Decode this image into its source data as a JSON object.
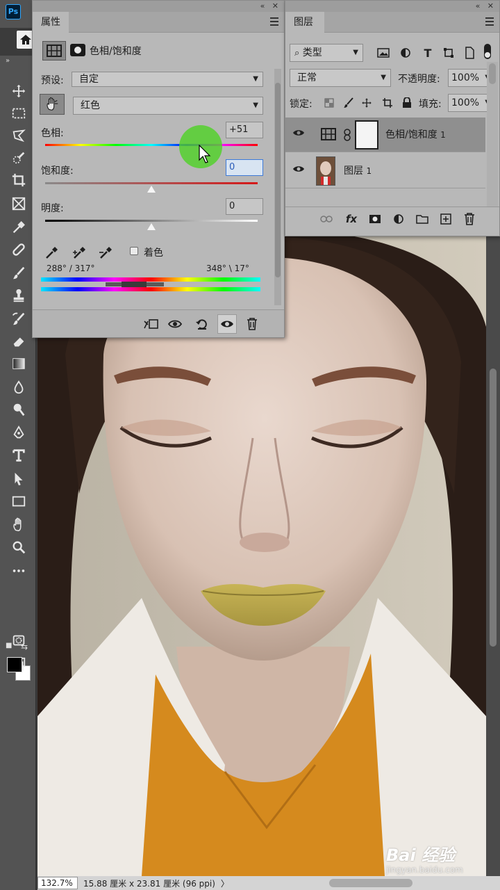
{
  "app": {
    "logo": "Ps"
  },
  "properties": {
    "tab_label": "属性",
    "title": "色相/饱和度",
    "preset_label": "预设:",
    "preset_value": "自定",
    "channel_value": "红色",
    "hue_label": "色相:",
    "hue_value": "+51",
    "saturation_label": "饱和度:",
    "saturation_value": "0",
    "lightness_label": "明度:",
    "lightness_value": "0",
    "colorize_label": "着色",
    "range_left": "288° / 317°",
    "range_right": "348° \\ 17°",
    "hue_slider_level": 0.75,
    "saturation_slider_level": 0.5,
    "lightness_slider_level": 0.5
  },
  "layers": {
    "tab_label": "图层",
    "filter_value": "类型",
    "blend_mode": "正常",
    "opacity_label": "不透明度:",
    "opacity_value": "100%",
    "lock_label": "锁定:",
    "fill_label": "填充:",
    "fill_value": "100%",
    "items": [
      {
        "name": "色相/饱和度",
        "suffix": "1"
      },
      {
        "name": "图层",
        "suffix": "1"
      }
    ]
  },
  "status": {
    "zoom": "132.7%",
    "doc_size": "15.88 厘米 x 23.81 厘米 (96 ppi)",
    "arrow": "〉"
  },
  "watermark": {
    "main": "Bai 经验",
    "url": "jingyan.baidu.com"
  },
  "colors": {
    "panel_bg": "#b8b8b8",
    "ui_dark": "#535353",
    "accent_blue": "#3d7ad8",
    "cursor_highlight": "#50d228"
  }
}
